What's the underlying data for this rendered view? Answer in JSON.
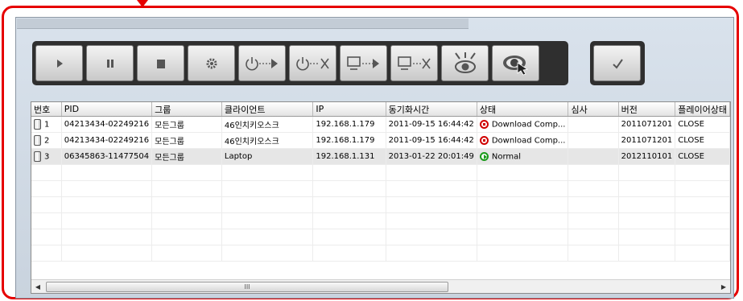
{
  "colors": {
    "highlight": "#e60000",
    "toolbar_bg": "#2f2f2f"
  },
  "toolbar": {
    "buttons": [
      {
        "name": "play-icon"
      },
      {
        "name": "pause-icon"
      },
      {
        "name": "stop-icon"
      },
      {
        "name": "settings-gear-icon"
      },
      {
        "name": "power-on-icon"
      },
      {
        "name": "power-off-icon"
      },
      {
        "name": "monitor-on-icon"
      },
      {
        "name": "monitor-off-icon"
      },
      {
        "name": "eye-closed-icon"
      },
      {
        "name": "eye-view-icon"
      }
    ],
    "confirm": {
      "name": "checkmark-icon"
    }
  },
  "table": {
    "headers": [
      "번호",
      "PID",
      "그룹",
      "클라이언트",
      "IP",
      "동기화시간",
      "상태",
      "심사",
      "버전",
      "플레이어상태"
    ],
    "rows": [
      {
        "no": "1",
        "pid": "04213434-02249216",
        "group": "모든그룹",
        "client": "46인치키오스크",
        "ip": "192.168.1.179",
        "sync": "2011-09-15 16:44:42",
        "status": "Download Comp...",
        "status_kind": "error",
        "review": "",
        "version": "2011071201",
        "player": "CLOSE"
      },
      {
        "no": "2",
        "pid": "04213434-02249216",
        "group": "모든그룹",
        "client": "46인치키오스크",
        "ip": "192.168.1.179",
        "sync": "2011-09-15 16:44:42",
        "status": "Download Comp...",
        "status_kind": "error",
        "review": "",
        "version": "2011071201",
        "player": "CLOSE"
      },
      {
        "no": "3",
        "pid": "06345863-11477504",
        "group": "모든그룹",
        "client": "Laptop",
        "ip": "192.168.1.131",
        "sync": "2013-01-22 20:01:49",
        "status": "Normal",
        "status_kind": "ok",
        "review": "",
        "version": "2012110101",
        "player": "CLOSE"
      }
    ]
  },
  "scrollbar": {
    "thumb_label": "III"
  }
}
